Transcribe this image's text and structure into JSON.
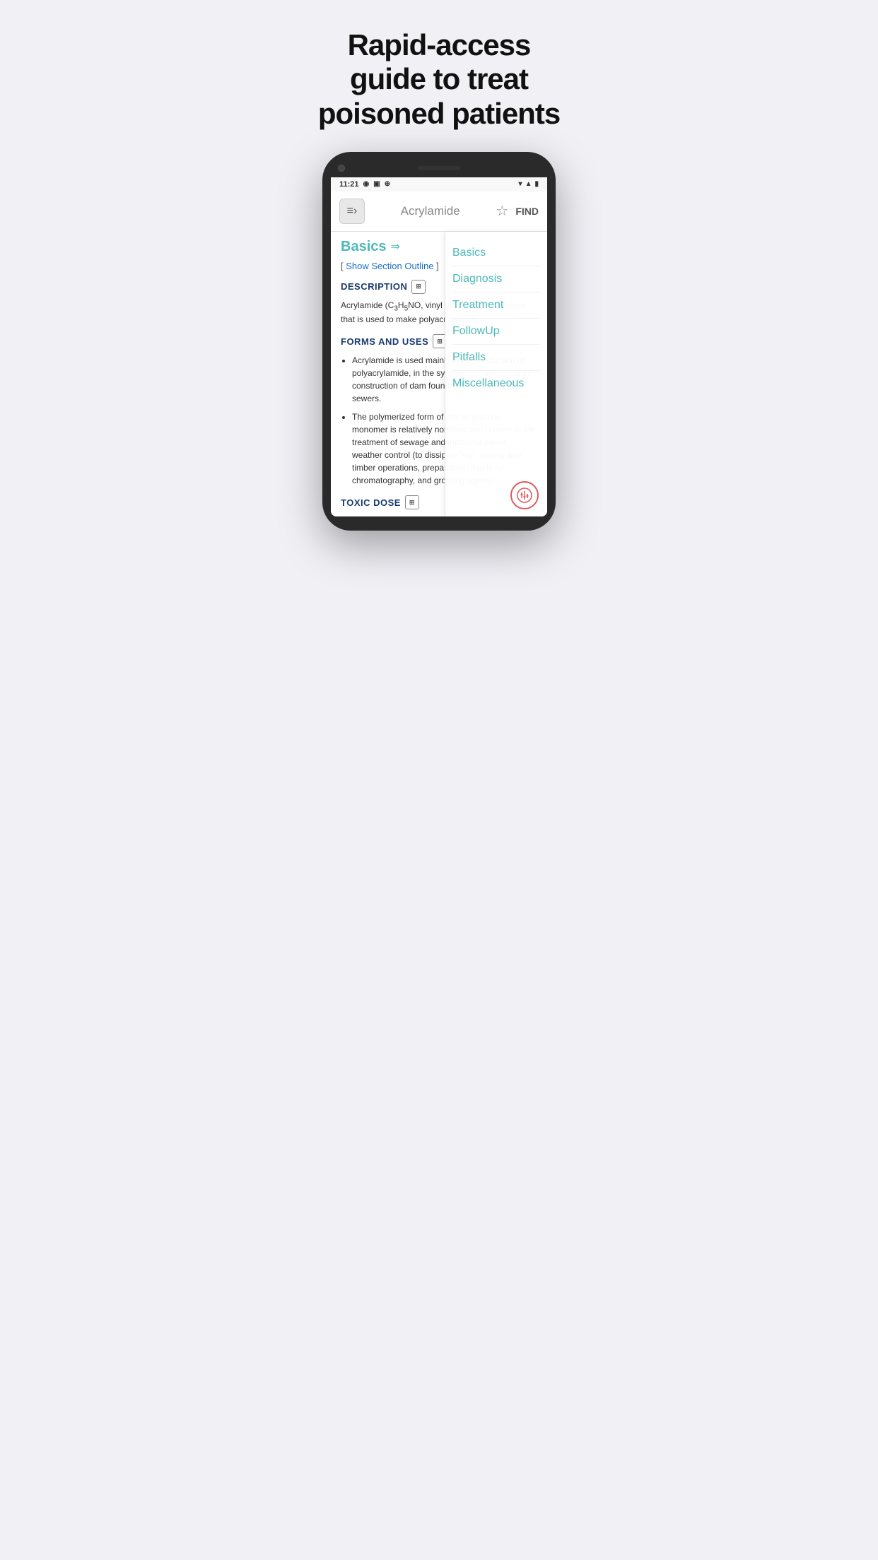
{
  "header": {
    "title": "Rapid-access guide to treat poisoned patients"
  },
  "status_bar": {
    "time": "11:21",
    "icons_left": [
      "location-icon",
      "sim-icon",
      "data-icon"
    ],
    "icons_right": [
      "wifi-icon",
      "signal-icon",
      "battery-icon"
    ]
  },
  "app_bar": {
    "title": "Acrylamide",
    "find_label": "FIND",
    "logo_symbol": "≡›"
  },
  "content": {
    "basics_label": "Basics",
    "show_outline_prefix": "[ ",
    "show_outline_link": "Show Section Outline",
    "show_outline_suffix": " ]",
    "description_heading": "DESCRIPTION",
    "description_text": "Acrylamide (C₃H₅NO, vinyl amide vinyl monomer that is used to make polyacrylamide.",
    "forms_uses_heading": "FORMS AND USES",
    "bullet1": "Acrylamide is used mainly in the production of polyacrylamide, in the synthesis of dyes, and in construction of dam foundations, tunnels, and sewers.",
    "bullet2": "The polymerized form of the acrylamide monomer is relatively nontoxic and is used in the treatment of sewage and industrial waste, weather control (to dissipate fog), mining and timber operations, preparation of gels for chromatography, and grouting agents.",
    "toxic_dose_heading": "TOXIC DOSE"
  },
  "nav_items": [
    {
      "label": "Basics"
    },
    {
      "label": "Diagnosis"
    },
    {
      "label": "Treatment"
    },
    {
      "label": "FollowUp"
    },
    {
      "label": "Pitfalls"
    },
    {
      "label": "Miscellaneous"
    }
  ]
}
